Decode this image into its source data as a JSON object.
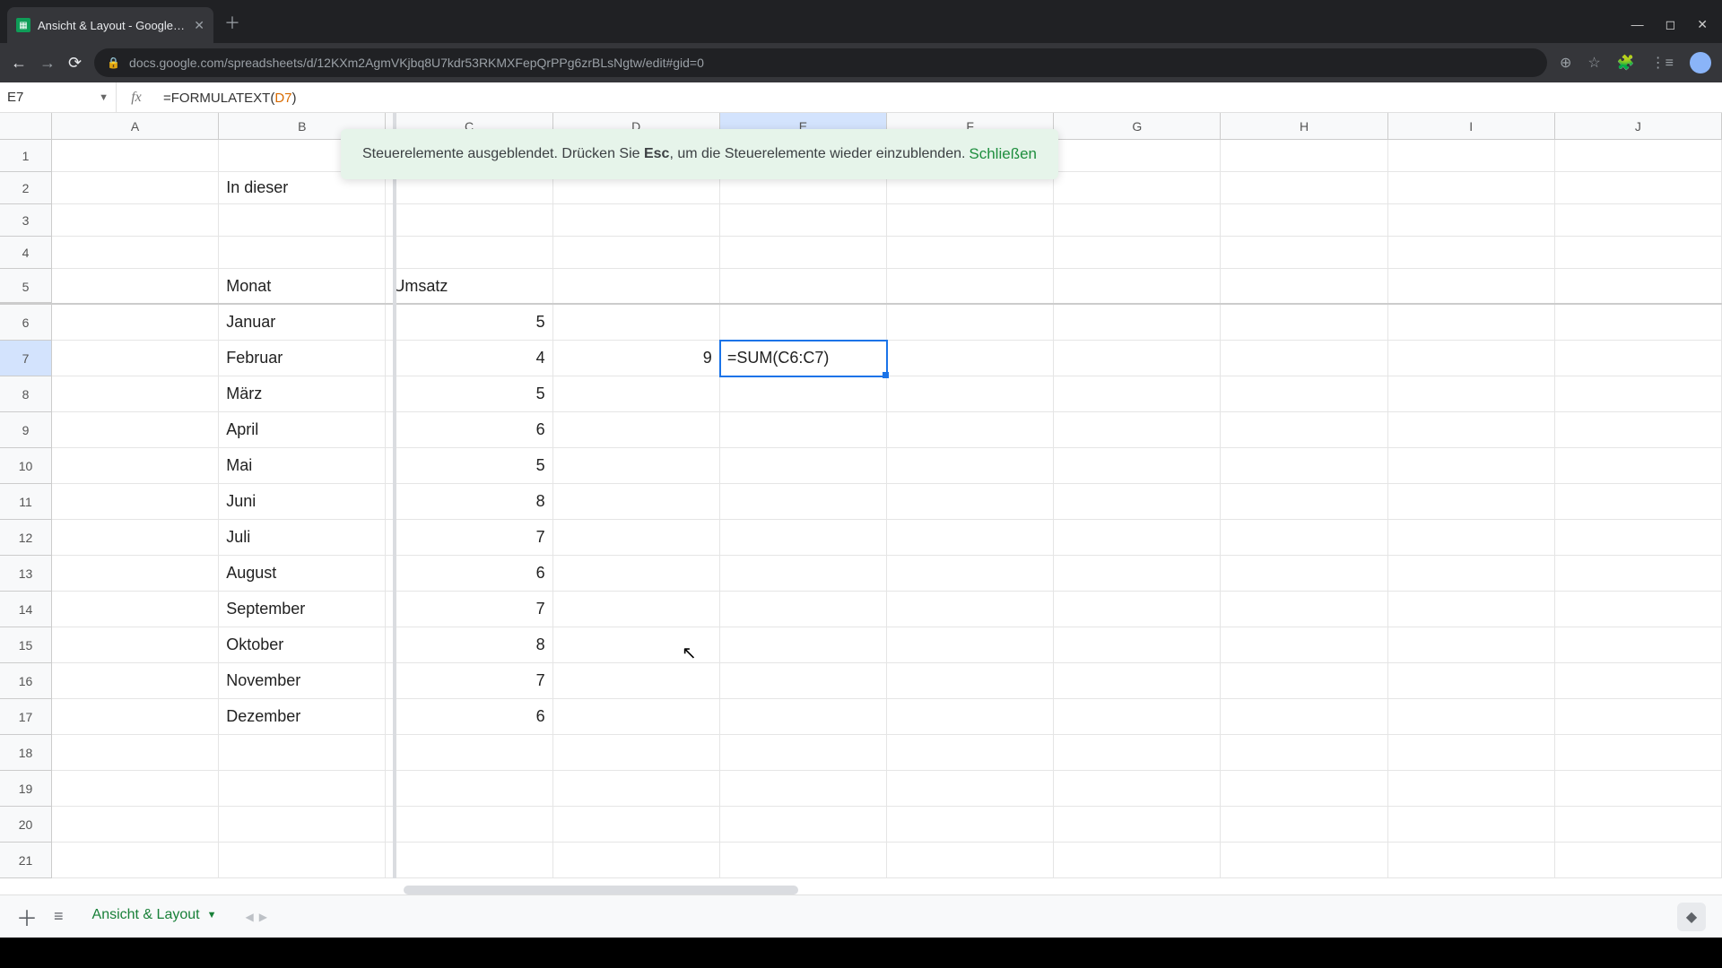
{
  "browser": {
    "tab_title": "Ansicht & Layout - Google Tabel",
    "url": "docs.google.com/spreadsheets/d/12KXm2AgmVKjbq8U7kdr53RKMXFepQrPPg6zrBLsNgtw/edit#gid=0"
  },
  "name_box": "E7",
  "formula_text_prefix": "=FORMULATEXT(",
  "formula_text_ref": "D7",
  "formula_text_suffix": ")",
  "columns": [
    "A",
    "B",
    "C",
    "D",
    "E",
    "F",
    "G",
    "H",
    "I",
    "J"
  ],
  "rows": [
    "1",
    "2",
    "3",
    "4",
    "5",
    "6",
    "7",
    "8",
    "9",
    "10",
    "11",
    "12",
    "13",
    "14",
    "15",
    "16",
    "17",
    "18",
    "19",
    "20",
    "21"
  ],
  "cells": {
    "B2": "In dieser",
    "B5": "Monat",
    "C5": "Umsatz",
    "B6": "Januar",
    "C6": "5",
    "B7": "Februar",
    "C7": "4",
    "D7": "9",
    "E7": "=SUM(C6:C7)",
    "B8": "März",
    "C8": "5",
    "B9": "April",
    "C9": "6",
    "B10": "Mai",
    "C10": "5",
    "B11": "Juni",
    "C11": "8",
    "B12": "Juli",
    "C12": "7",
    "B13": "August",
    "C13": "6",
    "B14": "September",
    "C14": "7",
    "B15": "Oktober",
    "C15": "8",
    "B16": "November",
    "C16": "7",
    "B17": "Dezember",
    "C17": "6"
  },
  "banner": {
    "text_before": "Steuerelemente ausgeblendet. Drücken Sie ",
    "key": "Esc",
    "text_after": ", um die Steuerelemente wieder einzublenden.",
    "close": "Schließen"
  },
  "sheet_tab": "Ansicht & Layout",
  "active_col": "E",
  "active_row": "7"
}
